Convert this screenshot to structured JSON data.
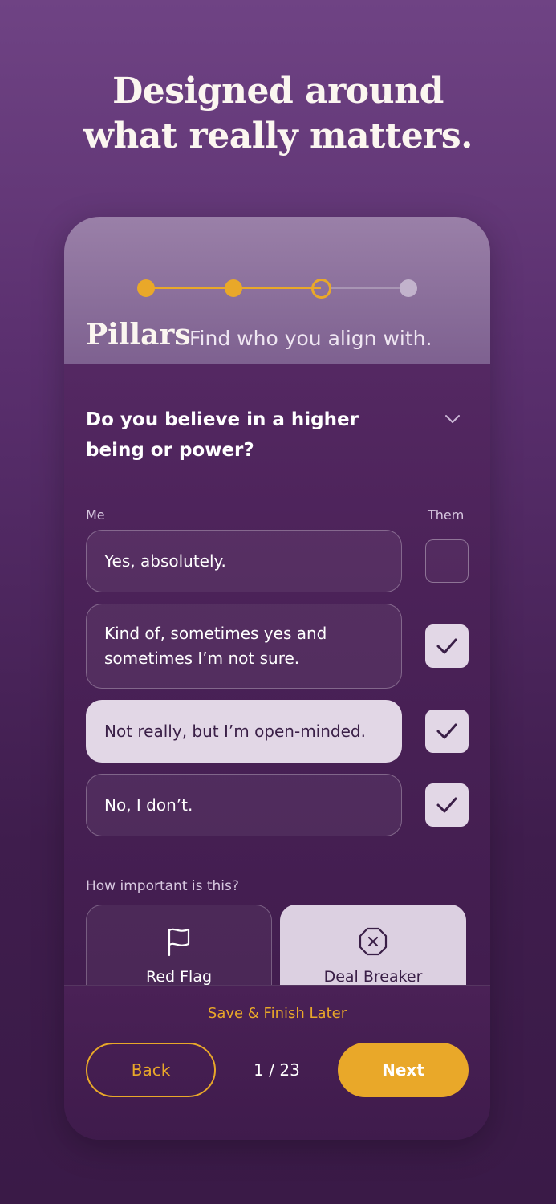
{
  "headline": {
    "line1": "Designed around",
    "line2": "what really matters."
  },
  "stepper": {
    "total": 4,
    "completed": 2,
    "current": 3
  },
  "section": {
    "title": "Pillars",
    "subtitle": "Find who you align with."
  },
  "question": {
    "text": "Do you believe in a higher being or power?"
  },
  "columns": {
    "me": "Me",
    "them": "Them"
  },
  "options": [
    {
      "label": "Yes, absolutely.",
      "me_selected": false,
      "them_checked": false
    },
    {
      "label": "Kind of, sometimes yes and sometimes I’m not sure.",
      "me_selected": false,
      "them_checked": true
    },
    {
      "label": "Not really, but I’m open-minded.",
      "me_selected": true,
      "them_checked": true
    },
    {
      "label": "No, I don’t.",
      "me_selected": false,
      "them_checked": true
    }
  ],
  "importance": {
    "label": "How important is this?",
    "red_flag": "Red Flag",
    "deal_breaker": "Deal Breaker",
    "selected": "deal_breaker"
  },
  "footer": {
    "save_later": "Save & Finish Later",
    "back": "Back",
    "pager": "1 / 23",
    "next": "Next"
  },
  "colors": {
    "accent": "#e9a829",
    "selected_bg": "#e2d7e6"
  }
}
